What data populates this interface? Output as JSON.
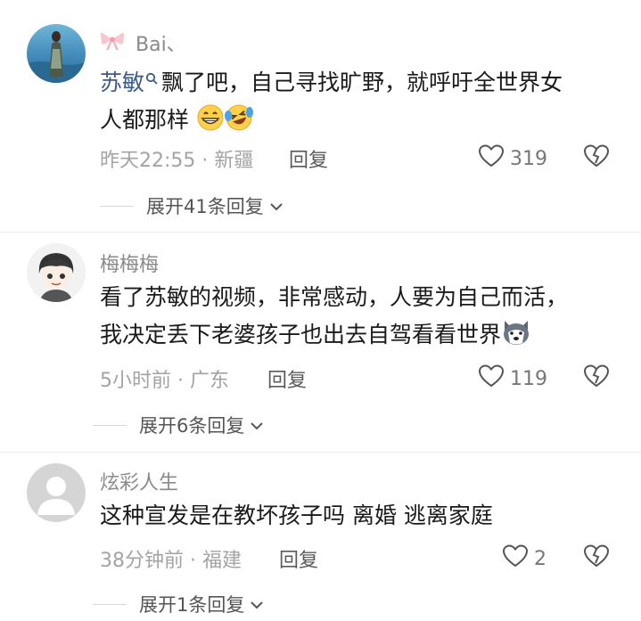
{
  "comments": [
    {
      "name": "Bai、",
      "mention": "苏敏",
      "text_line1": "飘了吧，自己寻找旷野，就呼吁全世界女",
      "text_line2": "人都那样",
      "time_location": "昨天22:55 · 新疆",
      "reply_label": "回复",
      "likes": "319",
      "expand_label": "展开41条回复"
    },
    {
      "name": "梅梅梅",
      "text_line1": "看了苏敏的视频，非常感动，人要为自己而活，",
      "text_line2": "我决定丢下老婆孩子也出去自驾看看世界",
      "time_location": "5小时前 · 广东",
      "reply_label": "回复",
      "likes": "119",
      "expand_label": "展开6条回复"
    },
    {
      "name": "炫彩人生",
      "text_line1": "这种宣发是在教坏孩子吗  离婚 逃离家庭",
      "time_location": "38分钟前 · 福建",
      "reply_label": "回复",
      "likes": "2",
      "expand_label": "展开1条回复"
    }
  ],
  "colors": {
    "name_gray": "#8a8a8a",
    "mention_blue": "#3a5b8c",
    "meta_gray": "#a3a3a3"
  },
  "icons": [
    "bow-icon",
    "search-mention-icon",
    "grin-emoji",
    "laughing-tears-emoji",
    "husky-emoji",
    "heart-icon",
    "broken-heart-icon",
    "chevron-down-icon"
  ]
}
